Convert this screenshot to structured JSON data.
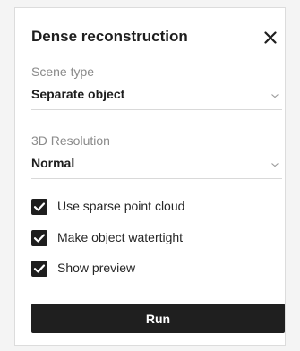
{
  "dialog": {
    "title": "Dense reconstruction",
    "close_icon": "close-icon"
  },
  "scene_type": {
    "label": "Scene type",
    "value": "Separate object",
    "chevron_icon": "chevron-down-icon"
  },
  "resolution": {
    "label": "3D Resolution",
    "value": "Normal",
    "chevron_icon": "chevron-down-icon"
  },
  "options": [
    {
      "label": "Use sparse point cloud",
      "checked": true
    },
    {
      "label": "Make object watertight",
      "checked": true
    },
    {
      "label": "Show preview",
      "checked": true
    }
  ],
  "actions": {
    "run_label": "Run"
  },
  "colors": {
    "accent": "#1f1f1f",
    "background": "#ffffff",
    "label_gray": "#8a8a8a"
  }
}
